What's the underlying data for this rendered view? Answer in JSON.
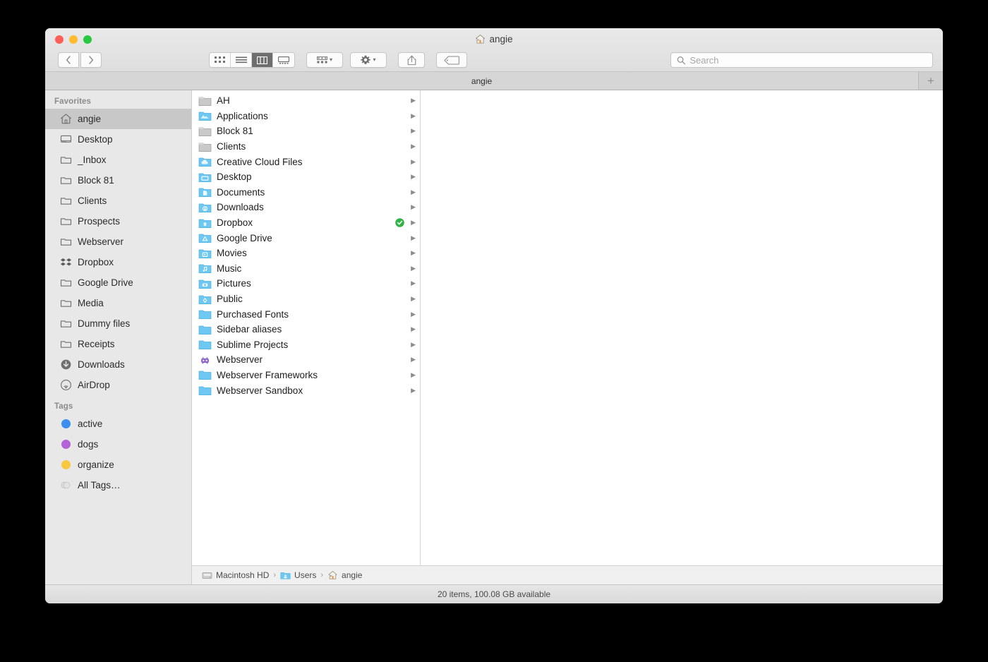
{
  "window": {
    "title": "angie",
    "title_icon": "home-icon",
    "traffic_lights": [
      {
        "name": "close",
        "color": "#ff5f57"
      },
      {
        "name": "minimize",
        "color": "#febc2e"
      },
      {
        "name": "zoom",
        "color": "#28c840"
      }
    ]
  },
  "toolbar": {
    "back_label": "‹",
    "forward_label": "›",
    "view_modes": [
      {
        "name": "icon-view",
        "active": false
      },
      {
        "name": "list-view",
        "active": false
      },
      {
        "name": "column-view",
        "active": true
      },
      {
        "name": "gallery-view",
        "active": false
      }
    ],
    "arrange_label": "",
    "action_label": "",
    "share_label": "",
    "tags_label": ""
  },
  "search": {
    "placeholder": "Search",
    "value": ""
  },
  "tabs": {
    "items": [
      {
        "label": "angie",
        "active": true
      }
    ],
    "add_label": "+"
  },
  "sidebar": {
    "sections": [
      {
        "title": "Favorites",
        "items": [
          {
            "label": "angie",
            "icon": "home-icon",
            "selected": true
          },
          {
            "label": "Desktop",
            "icon": "desktop-icon",
            "selected": false
          },
          {
            "label": "_Inbox",
            "icon": "folder-icon",
            "selected": false
          },
          {
            "label": "Block 81",
            "icon": "folder-icon",
            "selected": false
          },
          {
            "label": "Clients",
            "icon": "folder-icon",
            "selected": false
          },
          {
            "label": "Prospects",
            "icon": "folder-icon",
            "selected": false
          },
          {
            "label": "Webserver",
            "icon": "folder-icon",
            "selected": false
          },
          {
            "label": "Dropbox",
            "icon": "dropbox-icon",
            "selected": false
          },
          {
            "label": "Google Drive",
            "icon": "folder-icon",
            "selected": false
          },
          {
            "label": "Media",
            "icon": "folder-icon",
            "selected": false
          },
          {
            "label": "Dummy files",
            "icon": "folder-icon",
            "selected": false
          },
          {
            "label": "Receipts",
            "icon": "folder-icon",
            "selected": false
          },
          {
            "label": "Downloads",
            "icon": "downloads-icon",
            "selected": false
          },
          {
            "label": "AirDrop",
            "icon": "airdrop-icon",
            "selected": false
          }
        ]
      },
      {
        "title": "Tags",
        "items": [
          {
            "label": "active",
            "icon": "tag-dot",
            "color": "#3b8fef"
          },
          {
            "label": "dogs",
            "icon": "tag-dot",
            "color": "#b562d6"
          },
          {
            "label": "organize",
            "icon": "tag-dot",
            "color": "#f7c83f"
          },
          {
            "label": "All Tags…",
            "icon": "all-tags-icon",
            "color": "#d0d0d0"
          }
        ]
      }
    ]
  },
  "files": {
    "rows": [
      {
        "name": "AH",
        "icon": "folder-gray",
        "badge": "",
        "chevron": "▶"
      },
      {
        "name": "Applications",
        "icon": "folder-applications",
        "badge": "",
        "chevron": "▶"
      },
      {
        "name": "Block 81",
        "icon": "folder-gray",
        "badge": "",
        "chevron": "▶"
      },
      {
        "name": "Clients",
        "icon": "folder-gray",
        "badge": "",
        "chevron": "▶"
      },
      {
        "name": "Creative Cloud Files",
        "icon": "folder-blue-cloud",
        "badge": "",
        "chevron": "▶"
      },
      {
        "name": "Desktop",
        "icon": "folder-desktop",
        "badge": "",
        "chevron": "▶"
      },
      {
        "name": "Documents",
        "icon": "folder-documents",
        "badge": "",
        "chevron": "▶"
      },
      {
        "name": "Downloads",
        "icon": "folder-downloads",
        "badge": "",
        "chevron": "▶"
      },
      {
        "name": "Dropbox",
        "icon": "folder-dropbox",
        "badge": "sync-ok-badge",
        "chevron": "▶"
      },
      {
        "name": "Google Drive",
        "icon": "folder-googledrive",
        "badge": "",
        "chevron": "▶"
      },
      {
        "name": "Movies",
        "icon": "folder-movies",
        "badge": "",
        "chevron": "▶"
      },
      {
        "name": "Music",
        "icon": "folder-music",
        "badge": "",
        "chevron": "▶"
      },
      {
        "name": "Pictures",
        "icon": "folder-pictures",
        "badge": "",
        "chevron": "▶"
      },
      {
        "name": "Public",
        "icon": "folder-public",
        "badge": "",
        "chevron": "▶"
      },
      {
        "name": "Purchased Fonts",
        "icon": "folder-blue",
        "badge": "",
        "chevron": "▶"
      },
      {
        "name": "Sidebar aliases",
        "icon": "folder-blue",
        "badge": "",
        "chevron": "▶"
      },
      {
        "name": "Sublime Projects",
        "icon": "folder-blue",
        "badge": "",
        "chevron": "▶"
      },
      {
        "name": "Webserver",
        "icon": "alien-icon",
        "badge": "",
        "chevron": "▶"
      },
      {
        "name": "Webserver Frameworks",
        "icon": "folder-blue",
        "badge": "",
        "chevron": "▶"
      },
      {
        "name": "Webserver Sandbox",
        "icon": "folder-blue",
        "badge": "",
        "chevron": "▶"
      }
    ]
  },
  "pathbar": {
    "items": [
      {
        "label": "Macintosh HD",
        "icon": "harddisk-icon"
      },
      {
        "label": "Users",
        "icon": "folder-users-icon"
      },
      {
        "label": "angie",
        "icon": "home-icon"
      }
    ],
    "separator": "›"
  },
  "statusbar": {
    "text": "20 items, 100.08 GB available"
  }
}
